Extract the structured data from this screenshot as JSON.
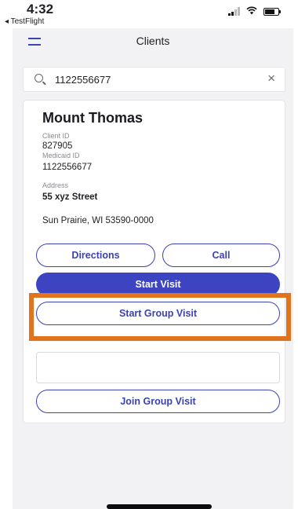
{
  "status_bar": {
    "time": "4:32",
    "back_app": "◂ TestFlight"
  },
  "nav": {
    "title": "Clients"
  },
  "search": {
    "value": "1122556677",
    "clear_glyph": "×"
  },
  "client": {
    "name": "Mount Thomas",
    "client_id_label": "Client ID",
    "client_id": "827905",
    "medicaid_id_label": "Medicaid ID",
    "medicaid_id": "1122556677",
    "address_label": "Address",
    "address_line1": "55 xyz Street",
    "address_line2": "Sun Prairie, WI 53590-0000"
  },
  "actions": {
    "directions": "Directions",
    "call": "Call",
    "start_visit": "Start Visit",
    "start_group_visit": "Start Group Visit",
    "join_group_visit": "Join Group Visit"
  },
  "colors": {
    "accent": "#3d44c1",
    "highlight": "#e0731b"
  }
}
